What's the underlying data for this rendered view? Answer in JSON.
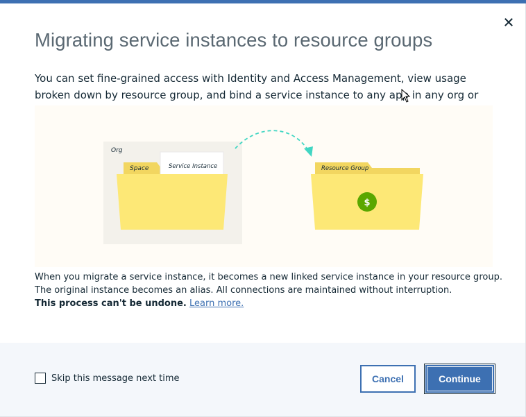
{
  "dialog": {
    "title": "Migrating service instances to resource groups",
    "intro": "You can set fine-grained access with Identity and Access Management, view usage broken down by resource group, and bind a service instance to any app in any org or space.",
    "illustration": {
      "org_label": "Org",
      "space_label": "Space",
      "service_instance_label": "Service Instance",
      "resource_group_label": "Resource Group",
      "dollar_symbol": "$"
    },
    "description_line1": "When you migrate a service instance, it becomes a new linked service instance in your resource group.",
    "description_line2": "The original instance becomes an alias. All connections are maintained without interruption.",
    "warning_text": "This process can't be undone.",
    "learn_more_link": "Learn more.",
    "close_icon": "close-icon"
  },
  "footer": {
    "skip_label": "Skip this message next time",
    "skip_checked": false,
    "cancel_label": "Cancel",
    "continue_label": "Continue"
  },
  "colors": {
    "accent": "#3d70b2",
    "title_gray": "#5a6872",
    "text_dark": "#152935",
    "folder_yellow": "#fde876",
    "folder_tab": "#f2d660",
    "arrow_teal": "#41d6c3",
    "dollar_green": "#5aa700",
    "footer_bg": "#f4f7fb"
  }
}
